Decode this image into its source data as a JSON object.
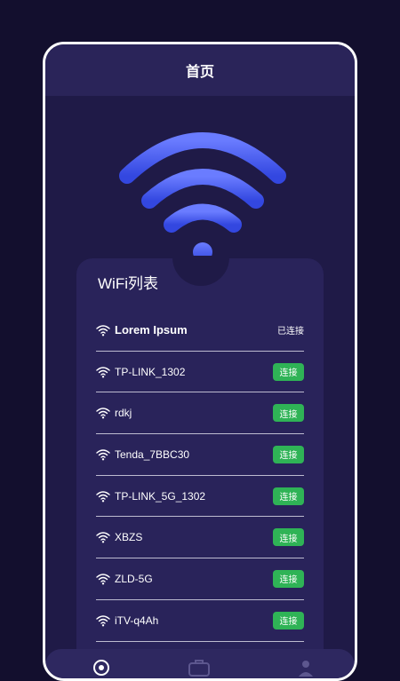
{
  "header": {
    "title": "首页"
  },
  "wifi_list": {
    "title": "WiFi列表",
    "items": [
      {
        "name": "Lorem Ipsum",
        "status": "已连接"
      },
      {
        "name": "TP-LINK_1302",
        "action": "连接"
      },
      {
        "name": "rdkj",
        "action": "连接"
      },
      {
        "name": "Tenda_7BBC30",
        "action": "连接"
      },
      {
        "name": "TP-LINK_5G_1302",
        "action": "连接"
      },
      {
        "name": "XBZS",
        "action": "连接"
      },
      {
        "name": "ZLD-5G",
        "action": "连接"
      },
      {
        "name": "iTV-q4Ah",
        "action": "连接"
      }
    ]
  },
  "colors": {
    "accent": "#4a5cf0",
    "connect": "#2fb356",
    "background": "#1f1a47"
  },
  "icons": {
    "hero": "wifi-icon",
    "row": "wifi-signal-icon",
    "nav": [
      "home-icon",
      "toolbox-icon",
      "profile-icon"
    ]
  }
}
